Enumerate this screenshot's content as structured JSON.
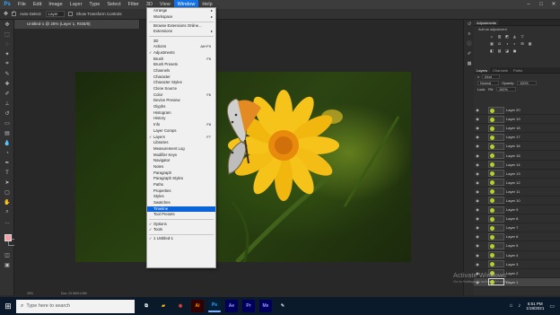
{
  "app": {
    "logo": "Ps"
  },
  "menubar": {
    "items": [
      "File",
      "Edit",
      "Image",
      "Layer",
      "Type",
      "Select",
      "Filter",
      "3D",
      "View",
      "Window",
      "Help"
    ],
    "active": "Window"
  },
  "window_controls": {
    "minimize": "–",
    "maximize": "□",
    "close": "✕"
  },
  "options_bar": {
    "tool_icon": "move-tool",
    "tool_glyph": "✥",
    "auto_select_label": "Auto-Select:",
    "auto_select_target": "Layer",
    "show_transform_label": "Show Transform Controls"
  },
  "toolbar": {
    "tools": [
      {
        "name": "move-tool-icon",
        "glyph": "✥"
      },
      {
        "name": "marquee-tool-icon",
        "glyph": "⬚"
      },
      {
        "name": "lasso-tool-icon",
        "glyph": "◌"
      },
      {
        "name": "magic-wand-tool-icon",
        "glyph": "✦"
      },
      {
        "name": "crop-tool-icon",
        "glyph": "⌗"
      },
      {
        "name": "eyedropper-tool-icon",
        "glyph": "✎"
      },
      {
        "name": "healing-brush-tool-icon",
        "glyph": "✚"
      },
      {
        "name": "brush-tool-icon",
        "glyph": "✐"
      },
      {
        "name": "clone-stamp-tool-icon",
        "glyph": "⊥"
      },
      {
        "name": "history-brush-tool-icon",
        "glyph": "↺"
      },
      {
        "name": "eraser-tool-icon",
        "glyph": "▭"
      },
      {
        "name": "gradient-tool-icon",
        "glyph": "▤"
      },
      {
        "name": "blur-tool-icon",
        "glyph": "💧"
      },
      {
        "name": "dodge-tool-icon",
        "glyph": "◔"
      },
      {
        "name": "pen-tool-icon",
        "glyph": "✒"
      },
      {
        "name": "type-tool-icon",
        "glyph": "T"
      },
      {
        "name": "path-selection-tool-icon",
        "glyph": "➤"
      },
      {
        "name": "rectangle-tool-icon",
        "glyph": "▢"
      },
      {
        "name": "hand-tool-icon",
        "glyph": "✋"
      },
      {
        "name": "zoom-tool-icon",
        "glyph": "⌕"
      },
      {
        "name": "more-tools-icon",
        "glyph": "…"
      }
    ],
    "foreground_color": "#f4a0a8",
    "background_color": "#2b2b2b",
    "extra_tools": [
      {
        "name": "quick-mask-icon",
        "glyph": "◫"
      },
      {
        "name": "screen-mode-icon",
        "glyph": "▣"
      }
    ]
  },
  "document": {
    "tab_title": "Untitled-1 @ 25% (Layer 1, RGB/8)",
    "zoom": "25%",
    "doc_size": "Doc: 23.9M/14.5M"
  },
  "window_menu": {
    "items": [
      {
        "type": "item",
        "label": "Arrange",
        "submenu": true
      },
      {
        "type": "item",
        "label": "Workspace",
        "submenu": true
      },
      {
        "type": "sep"
      },
      {
        "type": "item",
        "label": "Browse Extensions Online..."
      },
      {
        "type": "item",
        "label": "Extensions",
        "submenu": true
      },
      {
        "type": "sep"
      },
      {
        "type": "item",
        "label": "3D"
      },
      {
        "type": "item",
        "label": "Actions",
        "shortcut": "Alt+F9"
      },
      {
        "type": "item",
        "label": "Adjustments",
        "checked": true
      },
      {
        "type": "item",
        "label": "Brush",
        "shortcut": "F5"
      },
      {
        "type": "item",
        "label": "Brush Presets"
      },
      {
        "type": "item",
        "label": "Channels"
      },
      {
        "type": "item",
        "label": "Character"
      },
      {
        "type": "item",
        "label": "Character Styles"
      },
      {
        "type": "item",
        "label": "Clone Source"
      },
      {
        "type": "item",
        "label": "Color",
        "shortcut": "F6"
      },
      {
        "type": "item",
        "label": "Device Preview"
      },
      {
        "type": "item",
        "label": "Glyphs"
      },
      {
        "type": "item",
        "label": "Histogram"
      },
      {
        "type": "item",
        "label": "History"
      },
      {
        "type": "item",
        "label": "Info",
        "shortcut": "F8"
      },
      {
        "type": "item",
        "label": "Layer Comps"
      },
      {
        "type": "item",
        "label": "Layers",
        "shortcut": "F7",
        "checked": true
      },
      {
        "type": "item",
        "label": "Libraries"
      },
      {
        "type": "item",
        "label": "Measurement Log"
      },
      {
        "type": "item",
        "label": "Modifier Keys"
      },
      {
        "type": "item",
        "label": "Navigator"
      },
      {
        "type": "item",
        "label": "Notes"
      },
      {
        "type": "item",
        "label": "Paragraph"
      },
      {
        "type": "item",
        "label": "Paragraph Styles"
      },
      {
        "type": "item",
        "label": "Paths"
      },
      {
        "type": "item",
        "label": "Properties"
      },
      {
        "type": "item",
        "label": "Styles"
      },
      {
        "type": "item",
        "label": "Swatches"
      },
      {
        "type": "item",
        "label": "Timeline",
        "highlighted": true
      },
      {
        "type": "item",
        "label": "Tool Presets"
      },
      {
        "type": "sep"
      },
      {
        "type": "item",
        "label": "Options",
        "checked": true
      },
      {
        "type": "item",
        "label": "Tools",
        "checked": true
      },
      {
        "type": "sep"
      },
      {
        "type": "item",
        "label": "1 Untitled-1",
        "checked": true
      }
    ]
  },
  "dock_icons": [
    {
      "name": "history-panel-icon",
      "glyph": "↺"
    },
    {
      "name": "properties-panel-icon",
      "glyph": "≡"
    },
    {
      "name": "info-panel-icon",
      "glyph": "ⓘ"
    },
    {
      "name": "brush-panel-icon",
      "glyph": "✐"
    },
    {
      "name": "swatches-panel-icon",
      "glyph": "▦"
    }
  ],
  "adjustments_panel": {
    "tabs": [
      "Adjustments"
    ],
    "hint": "Add an adjustment",
    "row1": [
      "☼",
      "▥",
      "◩",
      "◭",
      "▽"
    ],
    "row2": [
      "▦",
      "⚖",
      "◑",
      "◐",
      "⊞",
      "▦"
    ],
    "row3": [
      "◧",
      "▨",
      "◪",
      "▣"
    ]
  },
  "layers_panel": {
    "tabs": [
      "Layers",
      "Channels",
      "Paths"
    ],
    "filter_label": "Kind",
    "blend_mode": "Normal",
    "opacity_label": "Opacity:",
    "opacity_value": "100%",
    "lock_label": "Lock:",
    "fill_label": "Fill:",
    "fill_value": "100%",
    "layers": [
      "Layer 20",
      "Layer 19",
      "Layer 18",
      "Layer 17",
      "Layer 16",
      "Layer 15",
      "Layer 14",
      "Layer 13",
      "Layer 12",
      "Layer 11",
      "Layer 10",
      "Layer 9",
      "Layer 8",
      "Layer 7",
      "Layer 6",
      "Layer 5",
      "Layer 4",
      "Layer 3",
      "Layer 2",
      "Layer 1"
    ],
    "selected": "Layer 1"
  },
  "watermark": {
    "title": "Activate Windows",
    "subtitle": "Go to Settings to activate Windows."
  },
  "taskbar": {
    "search_placeholder": "Type here to search",
    "apps": [
      {
        "name": "task-view-icon",
        "glyph": "⧉",
        "color": "#ffffff",
        "bg": "transparent"
      },
      {
        "name": "file-explorer-icon",
        "glyph": "▰",
        "color": "#f5c518",
        "bg": "transparent"
      },
      {
        "name": "chrome-icon",
        "glyph": "◉",
        "color": "#e8453c",
        "bg": "transparent"
      },
      {
        "name": "illustrator-icon",
        "glyph": "Ai",
        "color": "#ff9a00",
        "bg": "#330000"
      },
      {
        "name": "photoshop-icon",
        "glyph": "Ps",
        "color": "#31a8ff",
        "bg": "#001e36"
      },
      {
        "name": "after-effects-icon",
        "glyph": "Ae",
        "color": "#9999ff",
        "bg": "#00005b"
      },
      {
        "name": "premiere-icon",
        "glyph": "Pr",
        "color": "#9999ff",
        "bg": "#00005b"
      },
      {
        "name": "media-encoder-icon",
        "glyph": "Me",
        "color": "#9999ff",
        "bg": "#00005b"
      },
      {
        "name": "inkscape-icon",
        "glyph": "✎",
        "color": "#dddddd",
        "bg": "transparent"
      }
    ],
    "time": "6:51 PM",
    "date": "1/19/2021"
  }
}
